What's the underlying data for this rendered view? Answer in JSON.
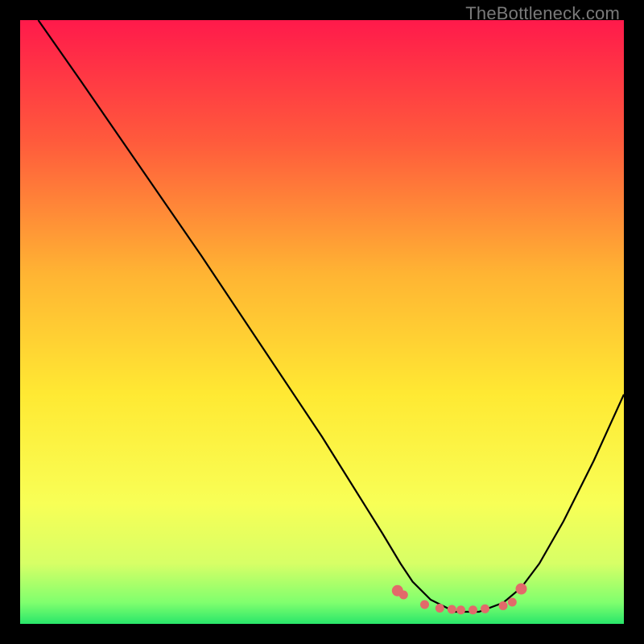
{
  "watermark": "TheBottleneck.com",
  "chart_data": {
    "type": "line",
    "title": "",
    "xlabel": "",
    "ylabel": "",
    "xlim": [
      0,
      100
    ],
    "ylim": [
      0,
      100
    ],
    "grid": false,
    "legend": false,
    "gradient_stops": [
      {
        "offset": 0.0,
        "color": "#ff1a4b"
      },
      {
        "offset": 0.2,
        "color": "#ff5a3c"
      },
      {
        "offset": 0.42,
        "color": "#ffb433"
      },
      {
        "offset": 0.62,
        "color": "#ffe933"
      },
      {
        "offset": 0.8,
        "color": "#f8ff56"
      },
      {
        "offset": 0.9,
        "color": "#d7ff66"
      },
      {
        "offset": 0.965,
        "color": "#7fff6e"
      },
      {
        "offset": 1.0,
        "color": "#29e66a"
      }
    ],
    "series": [
      {
        "name": "curve",
        "type": "line",
        "color": "#000000",
        "x": [
          3,
          10,
          20,
          30,
          40,
          50,
          55,
          60,
          63,
          65,
          68,
          72,
          76,
          80,
          83,
          86,
          90,
          95,
          100
        ],
        "y": [
          100,
          90,
          75.5,
          61,
          46,
          31,
          23,
          15,
          10,
          7,
          4,
          2,
          2,
          3.5,
          6,
          10,
          17,
          27,
          38
        ]
      },
      {
        "name": "optimum-markers",
        "type": "scatter",
        "color": "#e26a6a",
        "x": [
          62.5,
          63.5,
          67,
          69.5,
          71.5,
          73,
          75,
          77,
          80,
          81.5,
          83
        ],
        "y": [
          5.5,
          4.8,
          3.2,
          2.6,
          2.4,
          2.3,
          2.3,
          2.5,
          3.0,
          3.6,
          5.8
        ]
      }
    ]
  }
}
